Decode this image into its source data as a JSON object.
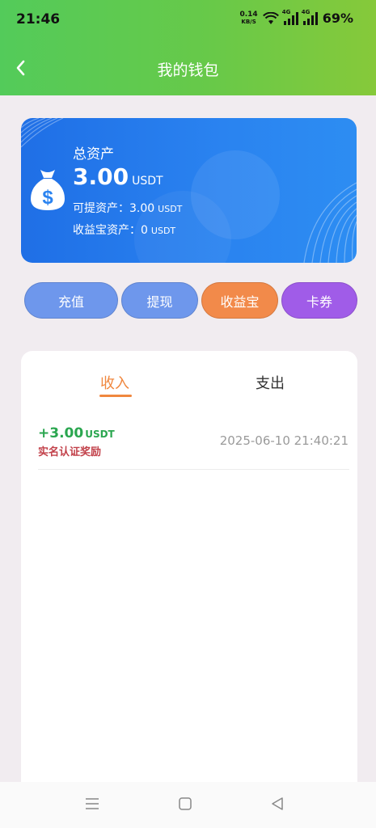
{
  "status_bar": {
    "time": "21:46",
    "net_speed_value": "0.14",
    "net_speed_unit": "KB/S",
    "network_label_1": "4G",
    "network_label_2": "4G",
    "battery": "69%"
  },
  "nav": {
    "title": "我的钱包",
    "back_icon": "chevron-left-icon"
  },
  "wallet": {
    "total_label": "总资产",
    "total_value": "3.00",
    "unit": "USDT",
    "withdrawable_label": "可提资产：",
    "withdrawable_value": "3.00",
    "yield_label": "收益宝资产：",
    "yield_value": "0",
    "icon": "money-bag-icon"
  },
  "actions": [
    {
      "label": "充值",
      "color": "#6e97ec"
    },
    {
      "label": "提现",
      "color": "#6e97ec"
    },
    {
      "label": "收益宝",
      "color": "#f28a4a"
    },
    {
      "label": "卡券",
      "color": "#a05ce8"
    }
  ],
  "tabs": {
    "income": "收入",
    "expense": "支出",
    "active": "income"
  },
  "records": [
    {
      "amount": "+3.00",
      "unit": "USDT",
      "description": "实名认证奖励",
      "time": "2025-06-10 21:40:21"
    }
  ],
  "colors": {
    "header_start": "#53cb5a",
    "header_end": "#86c93a",
    "card_blue": "#2a83f0",
    "active_tab": "#f0873e",
    "income_green": "#2aa64f",
    "desc_red": "#c2414a"
  }
}
